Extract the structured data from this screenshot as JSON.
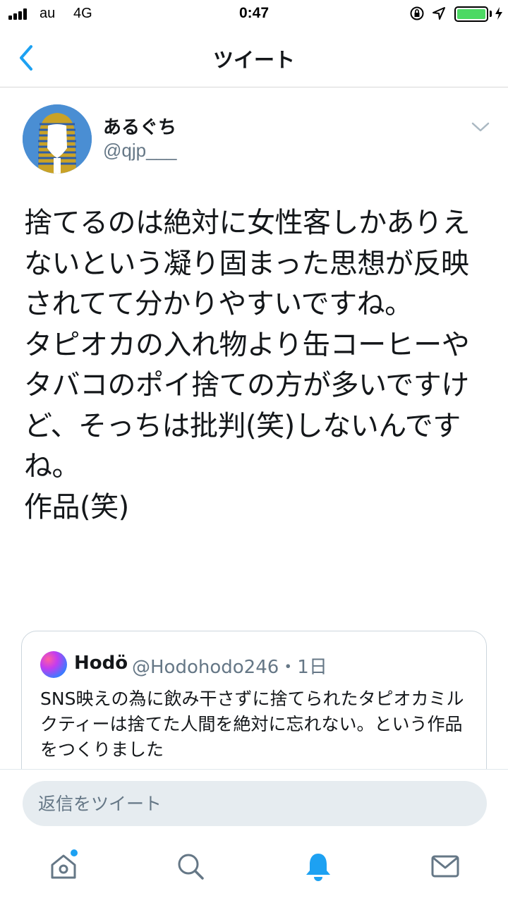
{
  "status_bar": {
    "carrier": "au",
    "network": "4G",
    "time": "0:47",
    "battery_level": 1.0,
    "icons": [
      "signal-icon",
      "orientation-lock-icon",
      "location-icon",
      "battery-icon",
      "charging-icon"
    ]
  },
  "nav": {
    "title": "ツイート",
    "back_icon": "chevron-left-icon"
  },
  "tweet": {
    "display_name": "あるぐち",
    "handle": "@qjp___",
    "text": "捨てるのは絶対に女性客しかありえないという凝り固まった思想が反映されてて分かりやすいですね。\nタピオカの入れ物より缶コーヒーやタバコのポイ捨ての方が多いですけど、そっちは批判(笑)しないんですね。\n作品(笑)",
    "menu_icon": "chevron-down-icon"
  },
  "quoted_tweet": {
    "display_name": "Hodö",
    "handle_time": "@Hodohodo246・1日",
    "text": "SNS映えの為に飲み干さずに捨てられたタピオカミルクティーは捨てた人間を絶対に忘れない。という作品をつくりました"
  },
  "reply": {
    "placeholder": "返信をツイート"
  },
  "tab_bar": {
    "items": [
      "home-icon",
      "search-icon",
      "notifications-icon",
      "messages-icon"
    ],
    "active": "notifications-icon",
    "accent_color": "#1da1f2",
    "inactive_color": "#657786"
  }
}
